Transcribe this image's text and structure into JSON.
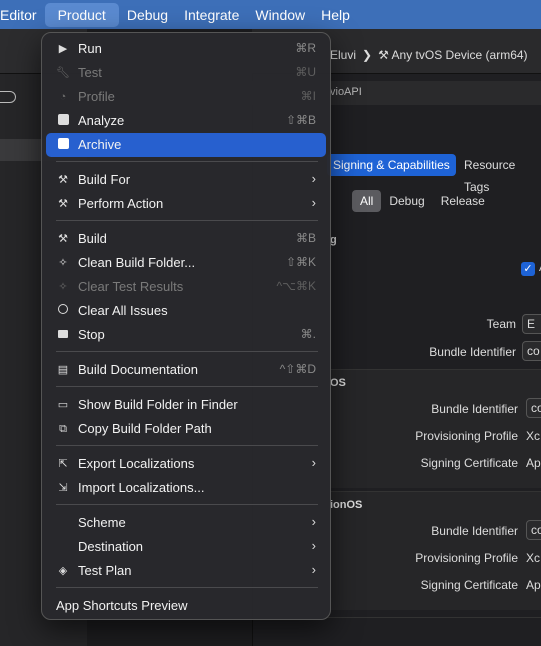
{
  "menubar": {
    "items": [
      "Editor",
      "Product",
      "Debug",
      "Integrate",
      "Window",
      "Help"
    ],
    "active": "Product"
  },
  "background": {
    "destination_prefix": "Eluvi",
    "destination_sep": "❯",
    "destination": "Any tvOS Device (arm64)",
    "crumb": "vioAPI",
    "tabs": {
      "selected": "Signing & Capabilities",
      "other": "Resource Tags"
    },
    "segments": [
      "All",
      "Debug",
      "Release"
    ],
    "section_header_1": "g",
    "checkbox_label": "A",
    "team_label": "Team",
    "team_value": "E",
    "bundle_id_label": "Bundle Identifier",
    "bundle_id_value": "co",
    "section_ios": "OS",
    "ios_bundle_label": "Bundle Identifier",
    "ios_bundle_value": "co",
    "ios_prov_label": "Provisioning Profile",
    "ios_prov_value": "Xc",
    "ios_cert_label": "Signing Certificate",
    "ios_cert_value": "Ap",
    "section_vision": "ionOS",
    "vis_bundle_label": "Bundle Identifier",
    "vis_bundle_value": "co",
    "vis_prov_label": "Provisioning Profile",
    "vis_prov_value": "Xc",
    "vis_cert_label": "Signing Certificate",
    "vis_cert_value": "Ap"
  },
  "menu": {
    "run": {
      "label": "Run",
      "shortcut": "⌘R"
    },
    "test": {
      "label": "Test",
      "shortcut": "⌘U"
    },
    "profile": {
      "label": "Profile",
      "shortcut": "⌘I"
    },
    "analyze": {
      "label": "Analyze",
      "shortcut": "⇧⌘B"
    },
    "archive": {
      "label": "Archive"
    },
    "build_for": {
      "label": "Build For"
    },
    "perform_action": {
      "label": "Perform Action"
    },
    "build": {
      "label": "Build",
      "shortcut": "⌘B"
    },
    "clean": {
      "label": "Clean Build Folder...",
      "shortcut": "⇧⌘K"
    },
    "clear_test": {
      "label": "Clear Test Results",
      "shortcut": "^⌥⌘K"
    },
    "clear_issues": {
      "label": "Clear All Issues"
    },
    "stop": {
      "label": "Stop",
      "shortcut": "⌘."
    },
    "build_doc": {
      "label": "Build Documentation",
      "shortcut": "^⇧⌘D"
    },
    "show_folder": {
      "label": "Show Build Folder in Finder"
    },
    "copy_path": {
      "label": "Copy Build Folder Path"
    },
    "export_loc": {
      "label": "Export Localizations"
    },
    "import_loc": {
      "label": "Import Localizations..."
    },
    "scheme": {
      "label": "Scheme"
    },
    "destination": {
      "label": "Destination"
    },
    "test_plan": {
      "label": "Test Plan"
    },
    "shortcuts_preview": {
      "label": "App Shortcuts Preview"
    },
    "submenu_glyph": "›"
  },
  "colors": {
    "highlight": "#2760cf",
    "menubar": "#3d6fb8",
    "accent": "#1e63d6"
  }
}
